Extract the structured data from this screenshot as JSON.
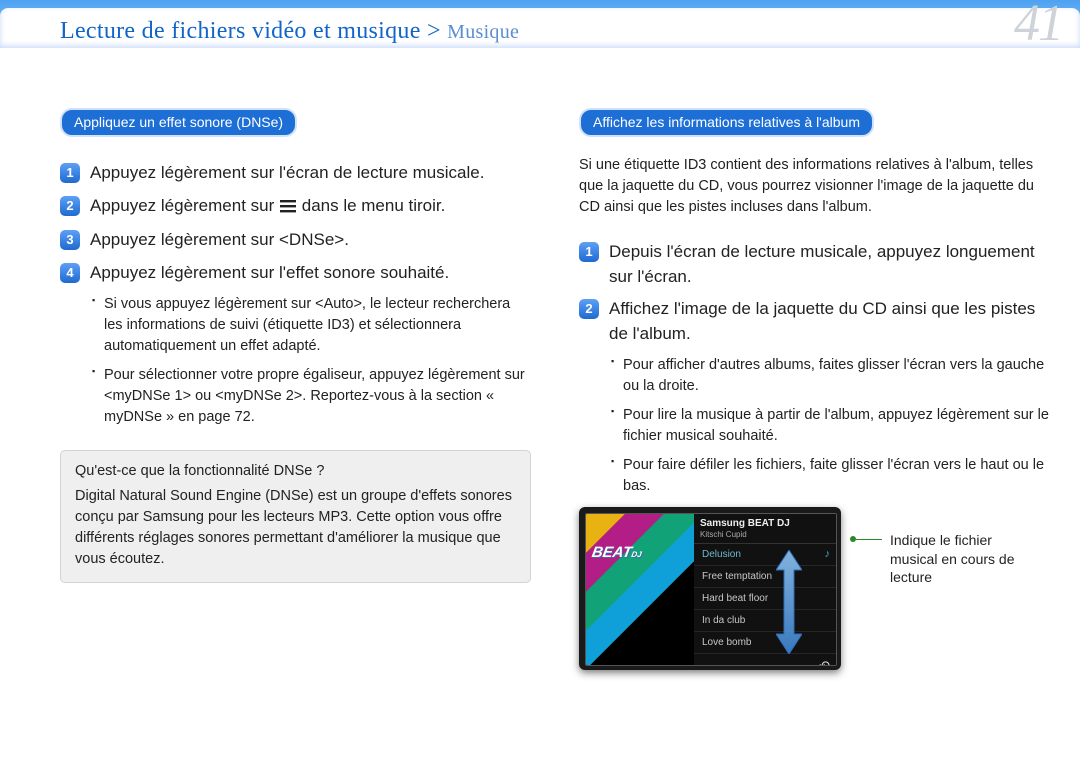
{
  "header": {
    "breadcrumb_main": "Lecture de fichiers vidéo et musique",
    "breadcrumb_sep": " > ",
    "breadcrumb_sub": "Musique",
    "page_number": "41"
  },
  "left": {
    "section_title": "Appliquez un effet sonore (DNSe)",
    "steps": [
      "Appuyez légèrement sur l'écran de lecture musicale.",
      "Appuyez légèrement sur   dans le menu tiroir.",
      "Appuyez légèrement sur <DNSe>.",
      "Appuyez légèrement sur l'effet sonore souhaité."
    ],
    "step2_before": "Appuyez légèrement sur ",
    "step2_after": " dans le menu tiroir.",
    "notes": [
      "Si vous appuyez légèrement sur <Auto>, le lecteur recherchera les informations de suivi (étiquette ID3) et sélectionnera automatiquement un effet adapté.",
      "Pour sélectionner votre propre égaliseur, appuyez légèrement sur <myDNSe 1> ou <myDNSe 2>. Reportez-vous à la section « myDNSe » en page 72."
    ],
    "info_q": "Qu'est-ce que la fonctionnalité DNSe ?",
    "info_a": "Digital Natural Sound Engine (DNSe) est un groupe d'effets sonores conçu par Samsung pour les lecteurs MP3. Cette option vous offre différents réglages sonores permettant d'améliorer la musique que vous écoutez."
  },
  "right": {
    "section_title": "Affichez les informations relatives à l'album",
    "intro": "Si une étiquette ID3 contient des informations relatives à l'album, telles que la jaquette du CD, vous pourrez visionner l'image de la jaquette du CD ainsi que les pistes incluses dans l'album.",
    "steps": [
      "Depuis l'écran de lecture musicale, appuyez longuement sur l'écran.",
      "Affichez l'image de la jaquette du CD ainsi que les pistes de l'album."
    ],
    "notes": [
      "Pour afficher d'autres albums, faites glisser l'écran vers la gauche ou la droite.",
      "Pour lire la musique à partir de l'album, appuyez légèrement sur le fichier musical souhaité.",
      "Pour faire défiler les fichiers, faite glisser l'écran vers le haut ou le bas."
    ],
    "device": {
      "album_title": "Samsung BEAT DJ",
      "album_artist": "Kitschi Cupid",
      "art_label": "BEAT",
      "art_label_sub": "DJ",
      "tracks": [
        "Delusion",
        "Free temptation",
        "Hard beat floor",
        "In da club",
        "Love bomb"
      ],
      "selected_index": 0
    },
    "callout": "Indique le fichier musical en cours de lecture"
  }
}
